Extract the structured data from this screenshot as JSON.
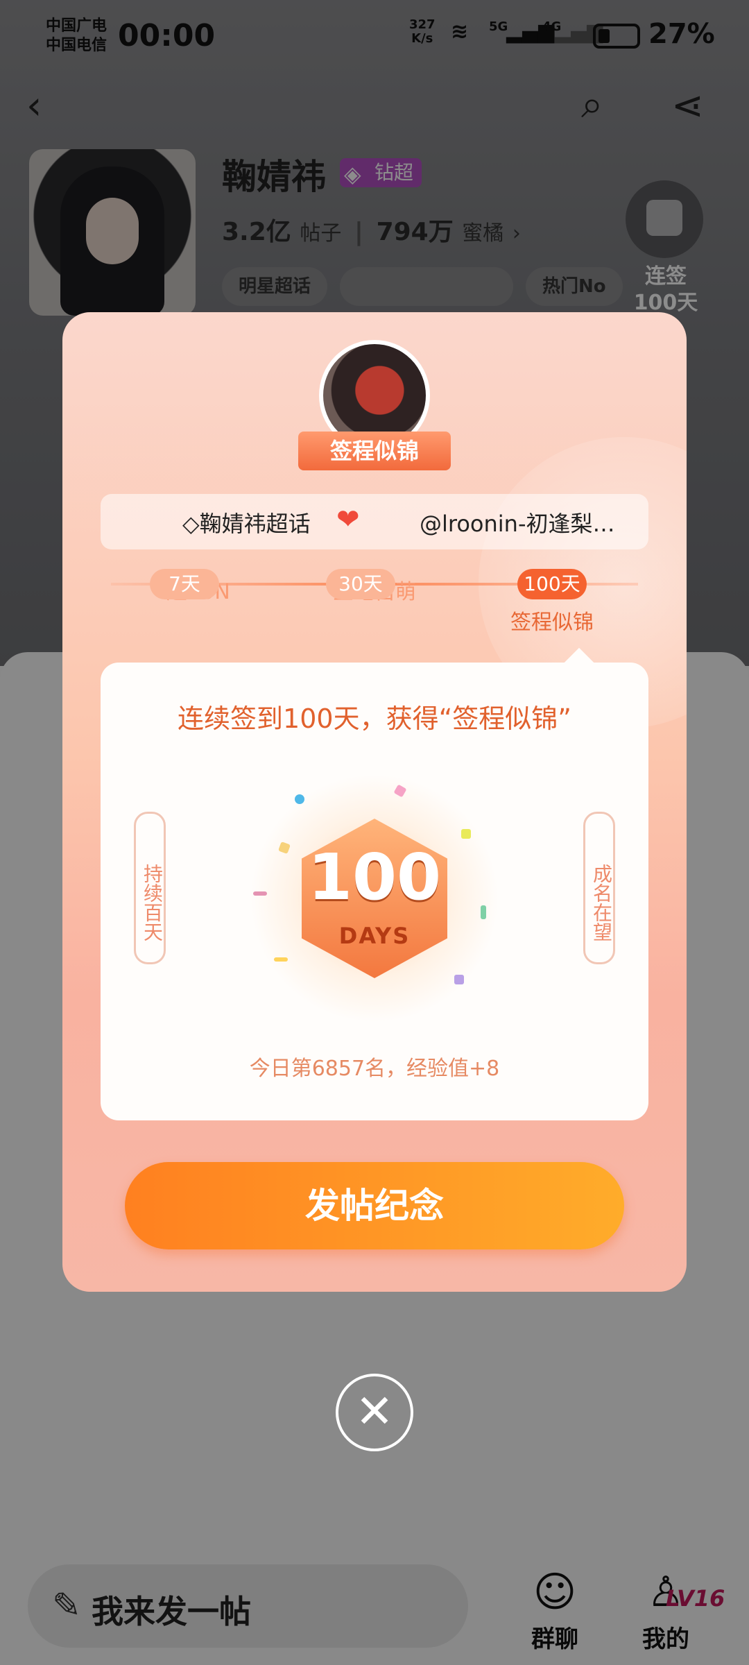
{
  "status_bar": {
    "carrier1": "中国广电",
    "carrier2": "中国电信",
    "time": "00:00",
    "speed": "327",
    "speed_unit": "K/s",
    "signal1": "5G",
    "signal2": "4G",
    "battery": "27%"
  },
  "profile": {
    "name": "鞠婧祎",
    "badge": "钻超",
    "posts_count": "3.2亿",
    "posts_label": "帖子",
    "fans_count": "794万",
    "fans_label": "蜜橘",
    "chips": [
      "明星超话",
      "热门No"
    ],
    "checkin_label1": "连签",
    "checkin_label2": "100天"
  },
  "modal": {
    "ribbon": "签程似锦",
    "pair_left": "鞠婧祎超话",
    "pair_right": "@lroonin-初逢梨…",
    "milestones": [
      {
        "days": "7天",
        "name": "超FUN",
        "active": false
      },
      {
        "days": "30天",
        "name": "签地自萌",
        "active": false
      },
      {
        "days": "100天",
        "name": "签程似锦",
        "active": true
      }
    ],
    "reward_title": "连续签到100天，获得“签程似锦”",
    "scroll_left": "持续百天",
    "scroll_right": "成名在望",
    "badge_number": "100",
    "badge_days": "DAYS",
    "rank_text": "今日第6857名，经验值+8",
    "cta": "发帖纪念"
  },
  "bottom_nav": {
    "post_placeholder": "我来发一帖",
    "group_chat": "群聊",
    "mine": "我的",
    "level": "LV16"
  },
  "colors": {
    "accent": "#f5622f",
    "cta_start": "#ff8020",
    "cta_end": "#ffac2a"
  }
}
